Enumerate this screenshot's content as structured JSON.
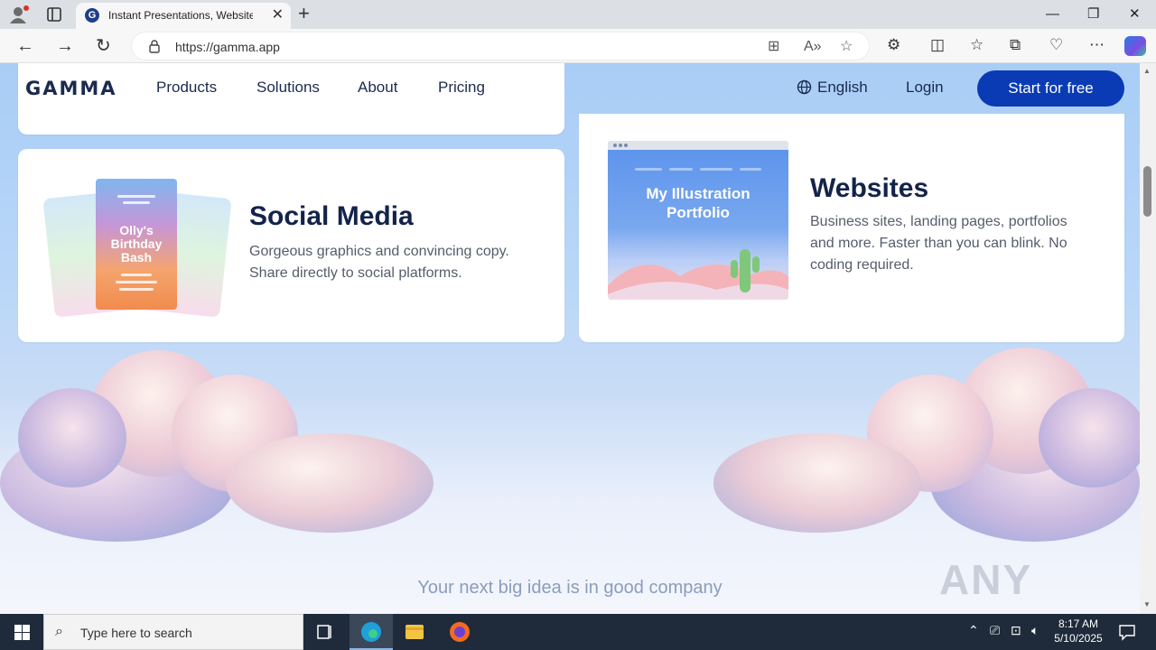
{
  "browser": {
    "tab_title": "Instant Presentations, Websites, a",
    "favicon_letter": "G",
    "url": "https://gamma.app"
  },
  "site": {
    "logo": "GAMMA",
    "nav": [
      "Products",
      "Solutions",
      "About",
      "Pricing"
    ],
    "language": "English",
    "login": "Login",
    "cta": "Start for free"
  },
  "cards": {
    "social": {
      "title": "Social Media",
      "desc_line1": "Gorgeous graphics and convincing copy.",
      "desc_line2": "Share directly to social platforms.",
      "illustration_line1": "Olly's",
      "illustration_line2": "Birthday",
      "illustration_line3": "Bash"
    },
    "websites": {
      "title": "Websites",
      "desc_line1": "Business sites, landing pages, portfolios",
      "desc_line2": "and more. Faster than you can blink. No",
      "desc_line3": "coding required.",
      "illustration_line1": "My Illustration",
      "illustration_line2": "Portfolio"
    }
  },
  "tagline": "Your next big idea is in good company",
  "watermark": "ANY RUN",
  "taskbar": {
    "search_placeholder": "Type here to search",
    "time": "8:17 AM",
    "date": "5/10/2025"
  },
  "colors": {
    "brand_dark": "#13234a",
    "cta_blue": "#0a3bb5",
    "sky": "#a9cdf6"
  }
}
